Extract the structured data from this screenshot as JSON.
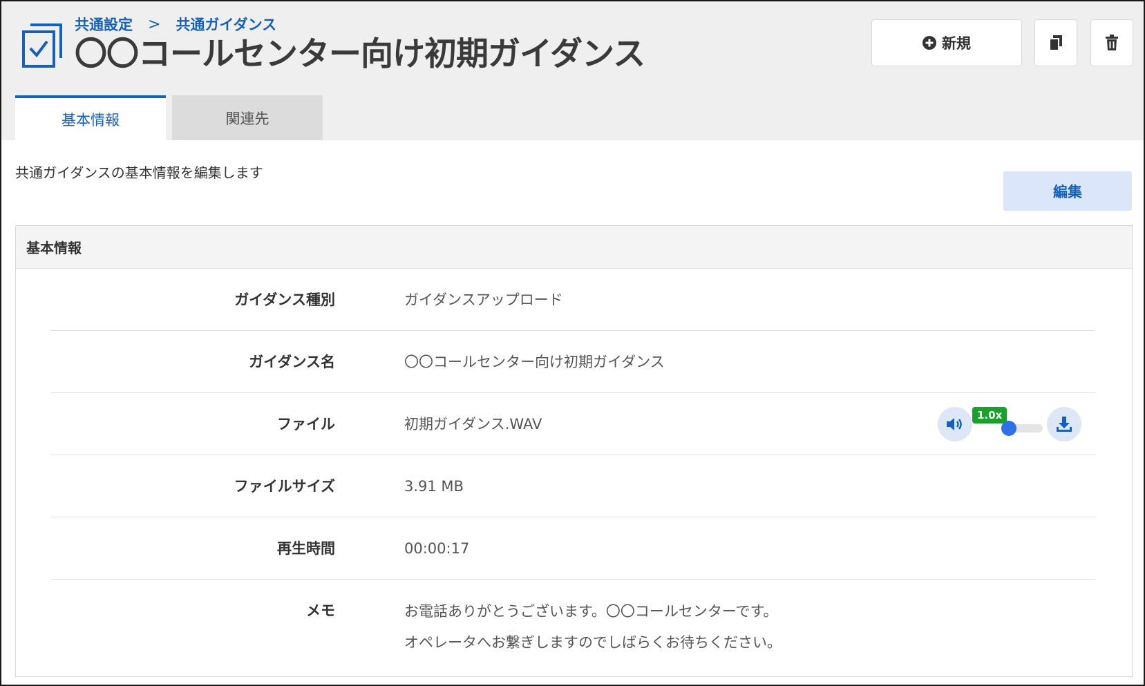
{
  "breadcrumb": {
    "items": [
      "共通設定",
      "共通ガイダンス"
    ],
    "separator": ">"
  },
  "page": {
    "title": "〇〇コールセンター向け初期ガイダンス"
  },
  "header_actions": {
    "new_label": "新規"
  },
  "tabs": [
    {
      "label": "基本情報",
      "active": true
    },
    {
      "label": "関連先",
      "active": false
    }
  ],
  "description": "共通ガイダンスの基本情報を編集します",
  "edit_button": {
    "label": "編集"
  },
  "panel": {
    "title": "基本情報",
    "rows": {
      "type": {
        "label": "ガイダンス種別",
        "value": "ガイダンスアップロード"
      },
      "name": {
        "label": "ガイダンス名",
        "value": "〇〇コールセンター向け初期ガイダンス"
      },
      "file": {
        "label": "ファイル",
        "value": "初期ガイダンス.WAV"
      },
      "size": {
        "label": "ファイルサイズ",
        "value": "3.91 MB"
      },
      "duration": {
        "label": "再生時間",
        "value": "00:00:17"
      },
      "memo": {
        "label": "メモ",
        "lines": [
          "お電話ありがとうございます。〇〇コールセンターです。",
          "オペレータへお繋ぎしますのでしばらくお待ちください。"
        ]
      }
    }
  },
  "audio_player": {
    "speed_label": "1.0x",
    "icons": [
      "volume-icon",
      "download-icon"
    ]
  },
  "colors": {
    "accent": "#1660b8",
    "edit_button_bg": "#dbe6fb",
    "speed_badge": "#1aa12b",
    "slider_thumb": "#2f6fe8"
  }
}
